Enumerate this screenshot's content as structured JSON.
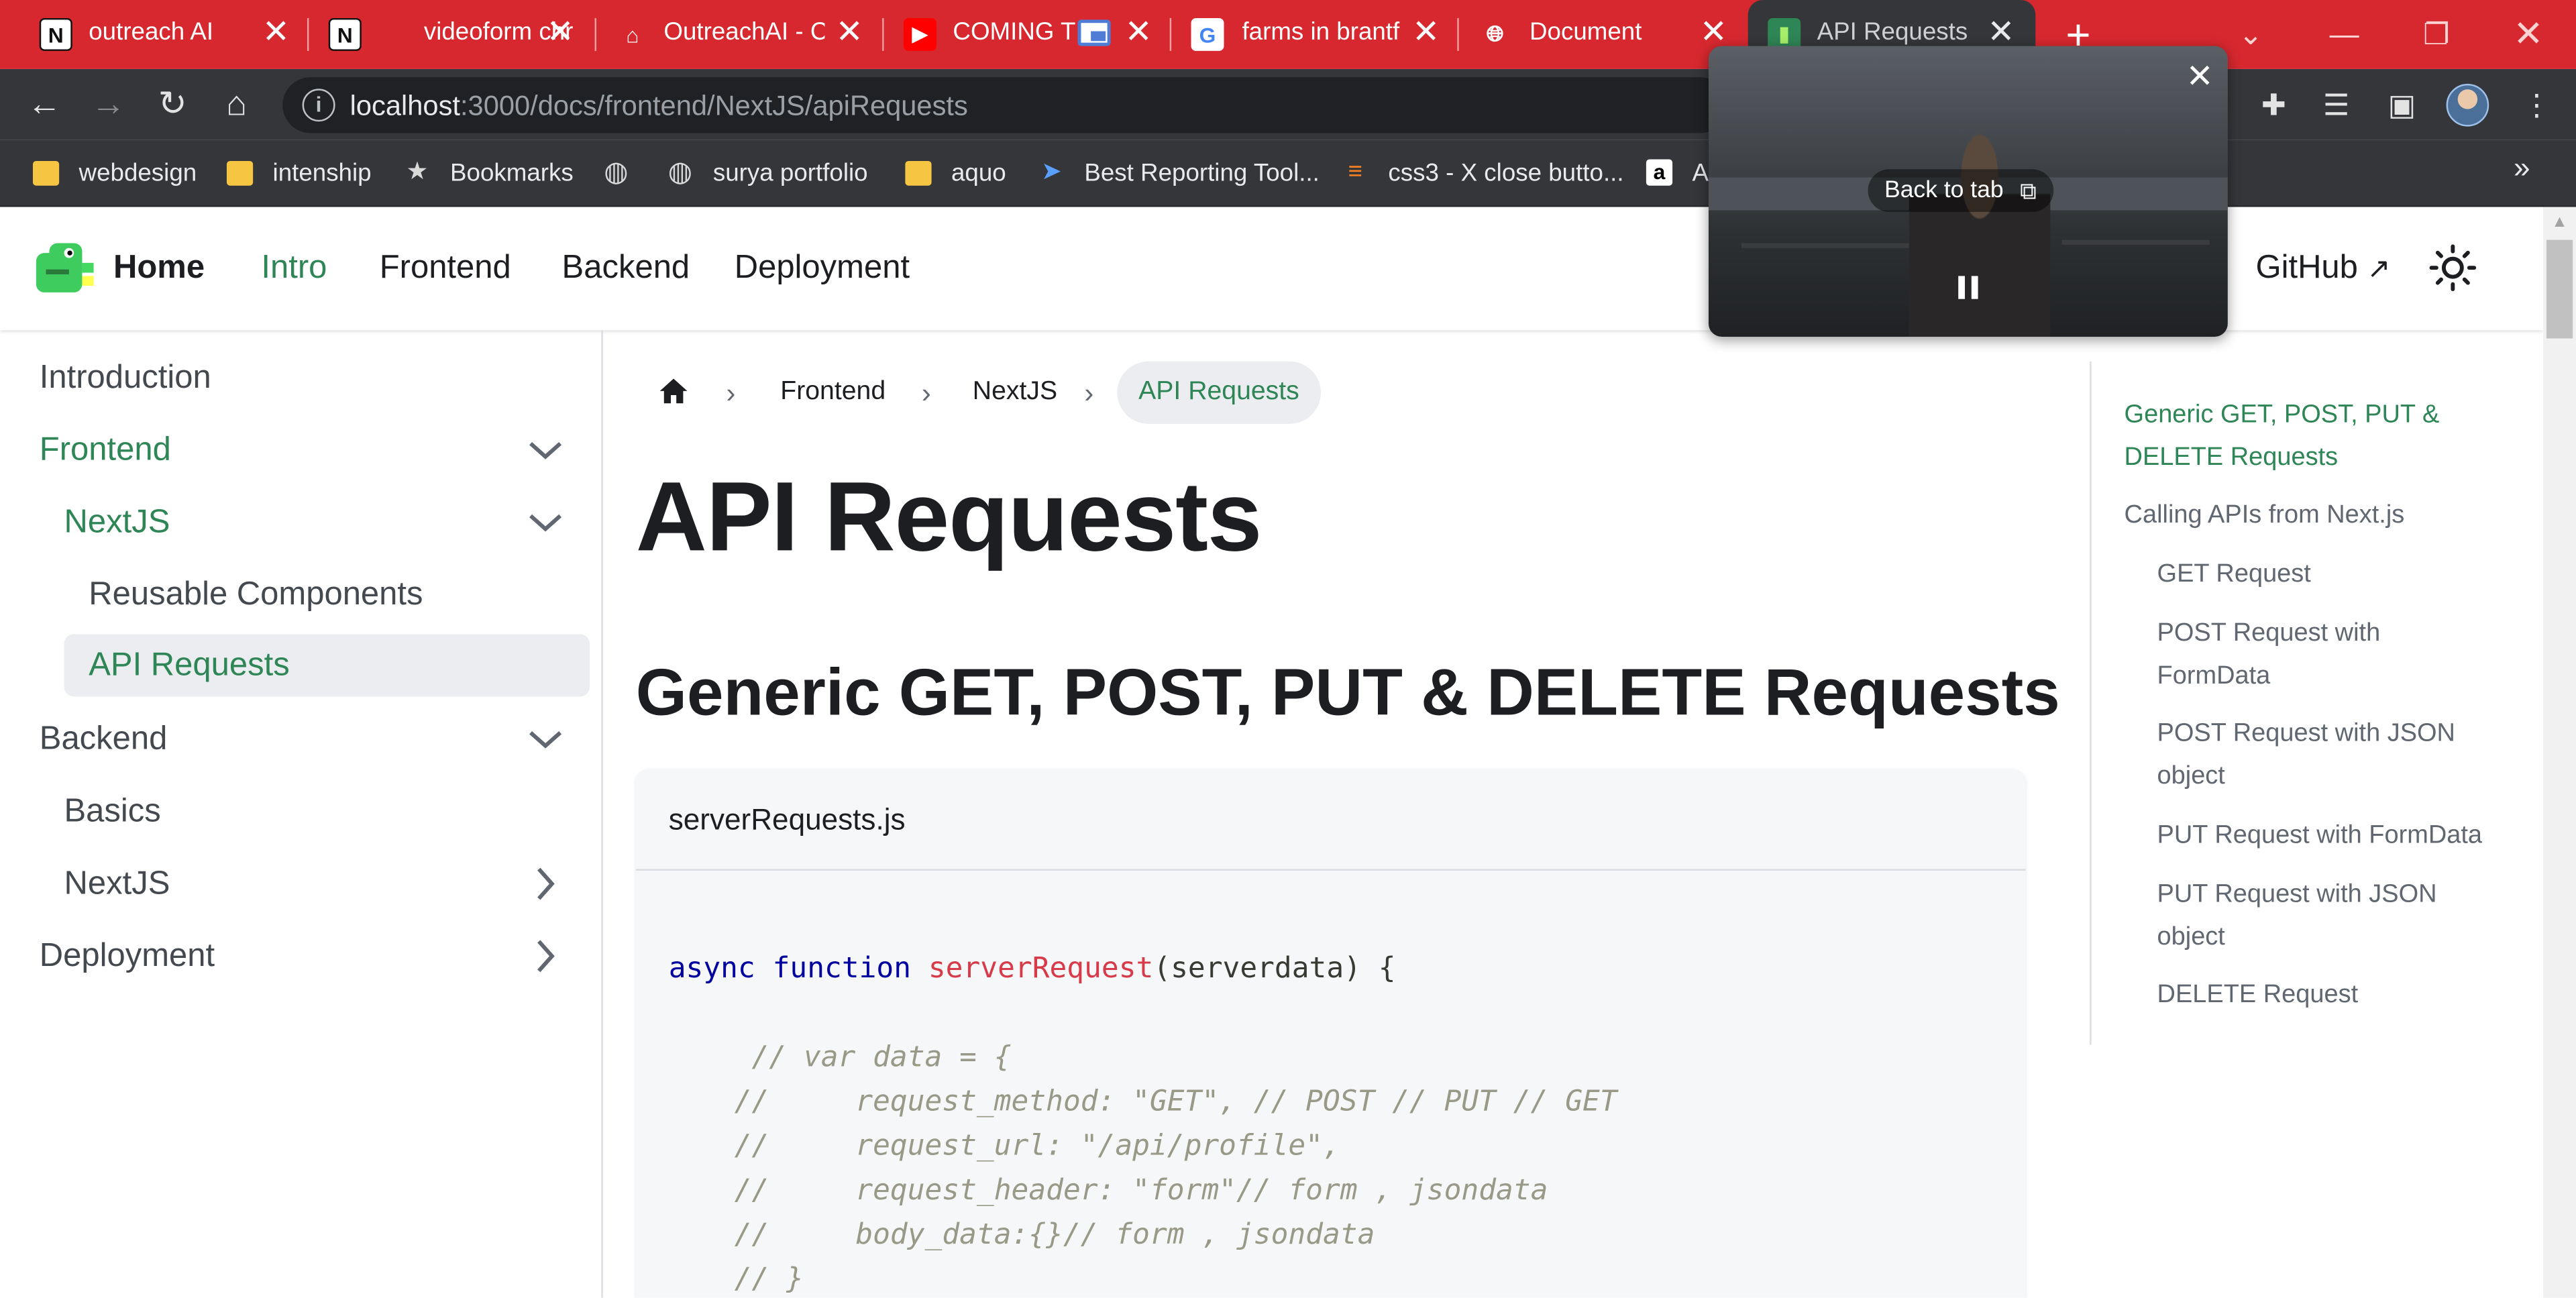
{
  "browser": {
    "tabs": [
      {
        "title": "outreach AI",
        "favicon": "notion-icon"
      },
      {
        "title": "videoform chr",
        "favicon": "notion-icon"
      },
      {
        "title": "OutreachAI - C",
        "favicon": "shop-icon"
      },
      {
        "title": "COMING T",
        "favicon": "youtube-icon"
      },
      {
        "title": "farms in brantf",
        "favicon": "google-icon"
      },
      {
        "title": "Document",
        "favicon": "globe-icon"
      },
      {
        "title": "API Requests |",
        "favicon": "docusaurus-icon",
        "active": true
      }
    ],
    "url_host": "localhost",
    "url_path": ":3000/docs/frontend/NextJS/apiRequests",
    "bookmarks": [
      {
        "label": "webdesign",
        "icon": "folder-icon"
      },
      {
        "label": "intenship",
        "icon": "folder-icon"
      },
      {
        "label": "Bookmarks",
        "icon": "star-icon"
      },
      {
        "label": "",
        "icon": "globe-icon"
      },
      {
        "label": "surya portfolio",
        "icon": "globe-icon"
      },
      {
        "label": "aquo",
        "icon": "folder-icon"
      },
      {
        "label": "Best Reporting Tool...",
        "icon": "plane-icon"
      },
      {
        "label": "css3 - X close butto...",
        "icon": "stackoverflow-icon"
      },
      {
        "label": "A",
        "icon": "amazon-icon"
      }
    ],
    "more_chevron": "»"
  },
  "pip": {
    "back_to_tab": "Back to tab"
  },
  "site": {
    "brand": "Home",
    "nav": [
      "Intro",
      "Frontend",
      "Backend",
      "Deployment"
    ],
    "github": "GitHub"
  },
  "sidebar": {
    "items": [
      {
        "label": "Introduction"
      },
      {
        "label": "Frontend",
        "caret": "down"
      },
      {
        "label": "NextJS",
        "caret": "down"
      },
      {
        "label": "Reusable Components"
      },
      {
        "label": "API Requests",
        "selected": true
      },
      {
        "label": "Backend",
        "caret": "down"
      },
      {
        "label": "Basics"
      },
      {
        "label": "NextJS",
        "caret": "right"
      },
      {
        "label": "Deployment",
        "caret": "right"
      }
    ]
  },
  "breadcrumbs": [
    "Frontend",
    "NextJS",
    "API Requests"
  ],
  "page": {
    "title": "API Requests",
    "section_heading": "Generic GET, POST, PUT & DELETE Requests",
    "code_title": "serverRequests.js",
    "code_lines": [
      {
        "kw1": "async",
        "kw2": "function",
        "fn": "serverRequest",
        "rest": "(serverdata) {"
      },
      {
        "comment": " // var data = {"
      },
      {
        "comment": "//     request_method: \"GET\", // POST // PUT // GET"
      },
      {
        "comment": "//     request_url: \"/api/profile\","
      },
      {
        "comment": "//     request_header: \"form\"// form , jsondata"
      },
      {
        "comment": "//     body_data:{}// form , jsondata"
      },
      {
        "comment": "// }"
      }
    ]
  },
  "toc": [
    {
      "label": "Generic GET, POST, PUT &",
      "label2": "DELETE Requests",
      "active": true
    },
    {
      "label": "Calling APIs from Next.js"
    },
    {
      "label": "GET Request"
    },
    {
      "label": "POST Request with",
      "label2": "FormData"
    },
    {
      "label": "POST Request with JSON",
      "label2": "object"
    },
    {
      "label": "PUT Request with FormData"
    },
    {
      "label": "PUT Request with JSON",
      "label2": "object"
    },
    {
      "label": "DELETE Request"
    }
  ],
  "colors": {
    "chrome_tabbar": "#d7282f",
    "chrome_toolbar": "#35363a",
    "accent_green": "#2e8555"
  }
}
